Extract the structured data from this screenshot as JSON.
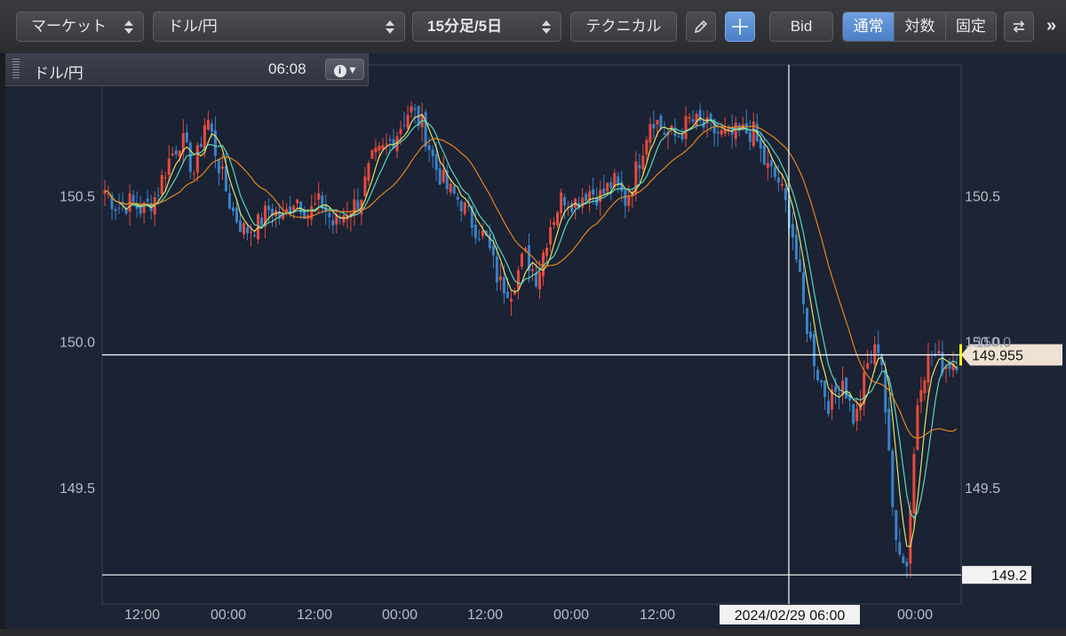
{
  "toolbar": {
    "market": "マーケット",
    "symbol": "ドル/円",
    "timeframe": "15分足/5日",
    "technical": "テクニカル",
    "bid": "Bid",
    "scale_normal": "通常",
    "scale_log": "対数",
    "scale_fixed": "固定",
    "more": "»"
  },
  "info": {
    "symbol": "ドル/円",
    "time": "06:08"
  },
  "chart_data": {
    "type": "candlestick",
    "symbol": "ドル/円",
    "timeframe": "15分足/5日",
    "ylim": [
      149.1,
      150.95
    ],
    "yticks": [
      "150.5",
      "150.0",
      "149.5"
    ],
    "xticks": [
      "12:00",
      "00:00",
      "12:00",
      "00:00",
      "12:00",
      "00:00",
      "12:00",
      "00:00"
    ],
    "close_series": [
      150.52,
      150.46,
      150.48,
      150.45,
      150.5,
      150.62,
      150.7,
      150.58,
      150.78,
      150.6,
      150.45,
      150.38,
      150.4,
      150.46,
      150.42,
      150.5,
      150.44,
      150.48,
      150.4,
      150.45,
      150.48,
      150.62,
      150.66,
      150.72,
      150.8,
      150.74,
      150.6,
      150.52,
      150.48,
      150.4,
      150.35,
      150.2,
      150.18,
      150.3,
      150.22,
      150.4,
      150.5,
      150.48,
      150.52,
      150.5,
      150.55,
      150.48,
      150.62,
      150.78,
      150.72,
      150.7,
      150.76,
      150.74,
      150.72,
      150.7,
      150.72,
      150.72,
      150.6,
      150.55,
      150.4,
      150.1,
      149.9,
      149.78,
      149.88,
      149.72,
      149.92,
      150.0,
      149.4,
      149.2,
      149.85,
      149.96,
      149.92,
      149.94
    ],
    "ma_fast": "#e8ec6a",
    "ma_mid": "#5ee0c0",
    "ma_slow": "#f08a1e",
    "up_color": "#e84a3c",
    "down_color": "#3a82c8",
    "price_line": "149.955",
    "low_line": "149.2",
    "crosshair_time": "2024/02/29 06:00",
    "crosshair_label": "150.0"
  },
  "colors": {
    "accent": "#4a7fc6",
    "chart_bg": "#1d2535",
    "grid": "#3a4558"
  }
}
